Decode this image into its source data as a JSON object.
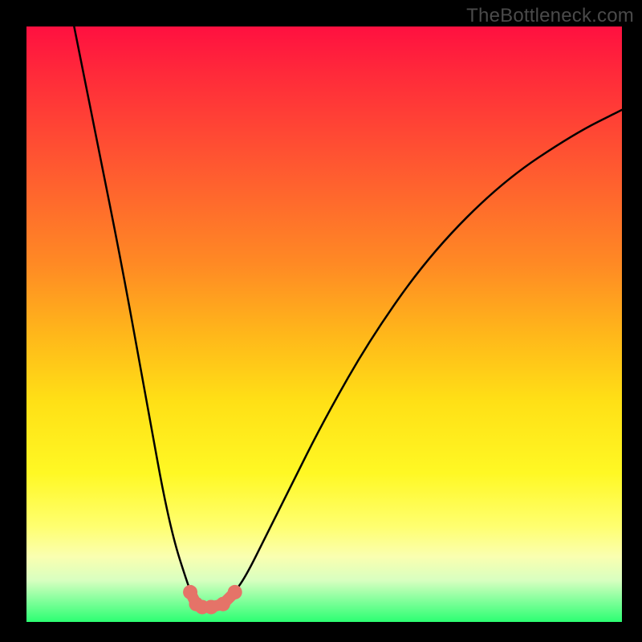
{
  "watermark": "TheBottleneck.com",
  "chart_data": {
    "type": "line",
    "title": "",
    "xlabel": "",
    "ylabel": "",
    "xlim": [
      0,
      100
    ],
    "ylim": [
      0,
      100
    ],
    "grid": false,
    "series": [
      {
        "name": "curve",
        "x": [
          8,
          12,
          16,
          20,
          24,
          27.5,
          28.5,
          29.5,
          31,
          33,
          35,
          37,
          40,
          44,
          50,
          58,
          68,
          80,
          92,
          100
        ],
        "y": [
          100,
          80,
          60,
          38,
          16,
          5,
          3,
          2.5,
          2.5,
          3,
          5,
          8,
          14,
          22,
          34,
          48,
          62,
          74,
          82,
          86
        ]
      },
      {
        "name": "dots",
        "x": [
          27.5,
          28.5,
          29.5,
          31,
          33,
          35
        ],
        "y": [
          5,
          3,
          2.5,
          2.5,
          3,
          5
        ]
      }
    ],
    "annotations": [
      {
        "text": "TheBottleneck.com",
        "position": "top-right"
      }
    ]
  }
}
